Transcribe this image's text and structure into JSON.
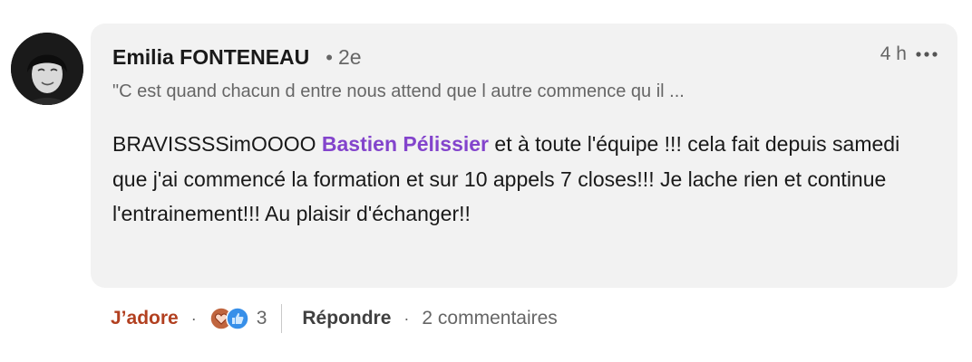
{
  "comment": {
    "author": {
      "name": "Emilia FONTENEAU",
      "degree_dot": "•",
      "degree": "2e",
      "headline": "\"C est quand chacun d entre nous attend que l autre commence qu il ..."
    },
    "time": "4 h",
    "text": {
      "before_mention": "BRAVISSSSimOOOO ",
      "mention": "Bastien Pélissier",
      "after_mention": " et à toute l'équipe !!! cela fait depuis samedi que j'ai commencé la formation et sur 10 appels 7 closes!!! Je lache rien et continue l'entrainement!!! Au plaisir d'échanger!!"
    },
    "actions": {
      "like_label": "J’adore",
      "dot": "·",
      "reaction_icons": [
        "love-icon",
        "like-icon"
      ],
      "reaction_count": "3",
      "reply_label": "Répondre",
      "replies_label": "2 commentaires"
    }
  },
  "colors": {
    "bubble_bg": "#f2f2f2",
    "mention": "#8344cc",
    "love_reaction": "#b24020",
    "like_reaction": "#378fe9",
    "text_primary": "#191919",
    "text_secondary": "#666666"
  }
}
